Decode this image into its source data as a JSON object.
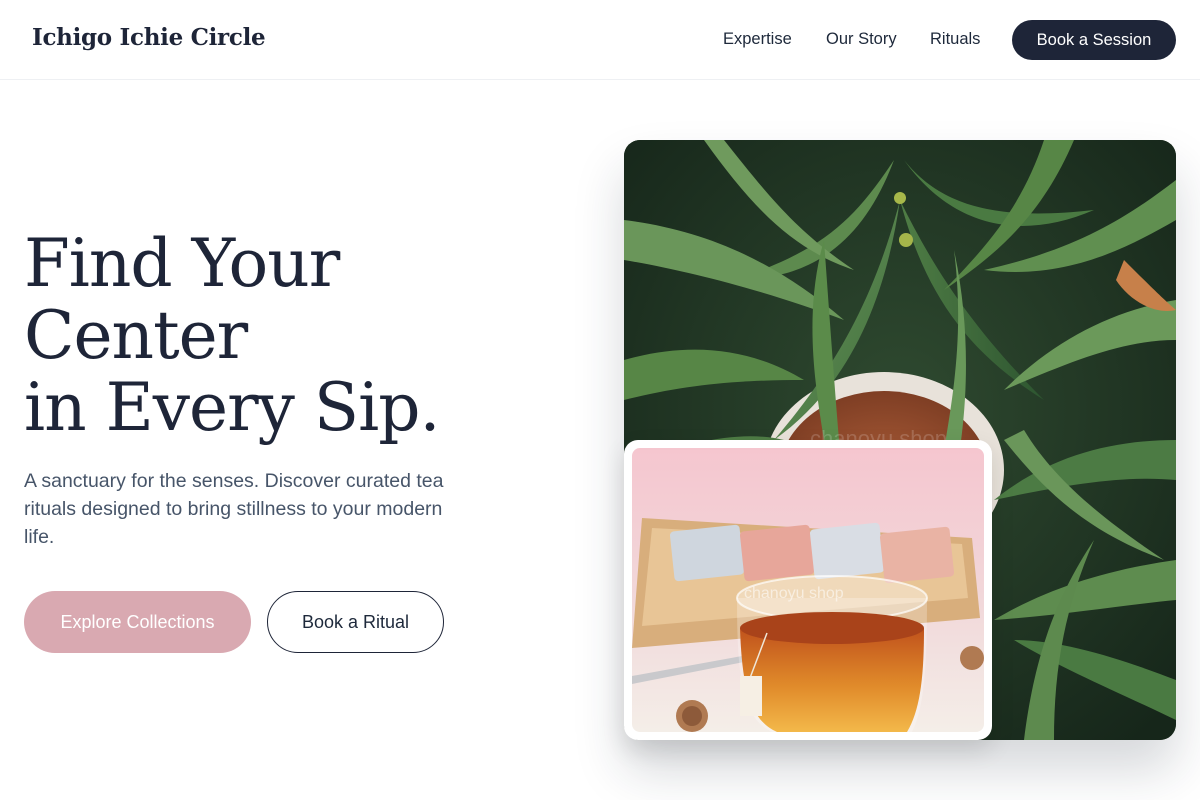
{
  "header": {
    "logo": "Ichigo Ichie Circle",
    "nav": [
      "Expertise",
      "Our Story",
      "Rituals"
    ],
    "cta": "Book a Session"
  },
  "hero": {
    "title_lines": [
      "Find Your",
      "Center",
      "in Every Sip."
    ],
    "subtitle": "A sanctuary for the senses. Discover curated tea rituals designed to bring stillness to your modern life.",
    "primary_button": "Explore Collections",
    "secondary_button": "Book a Ritual"
  },
  "images": {
    "main_watermark": "chanoyu shop",
    "inset_watermark": "chanoyu shop"
  },
  "colors": {
    "navy": "#1e2538",
    "accent_pink": "#d9a9b1",
    "body_text": "#475569"
  }
}
